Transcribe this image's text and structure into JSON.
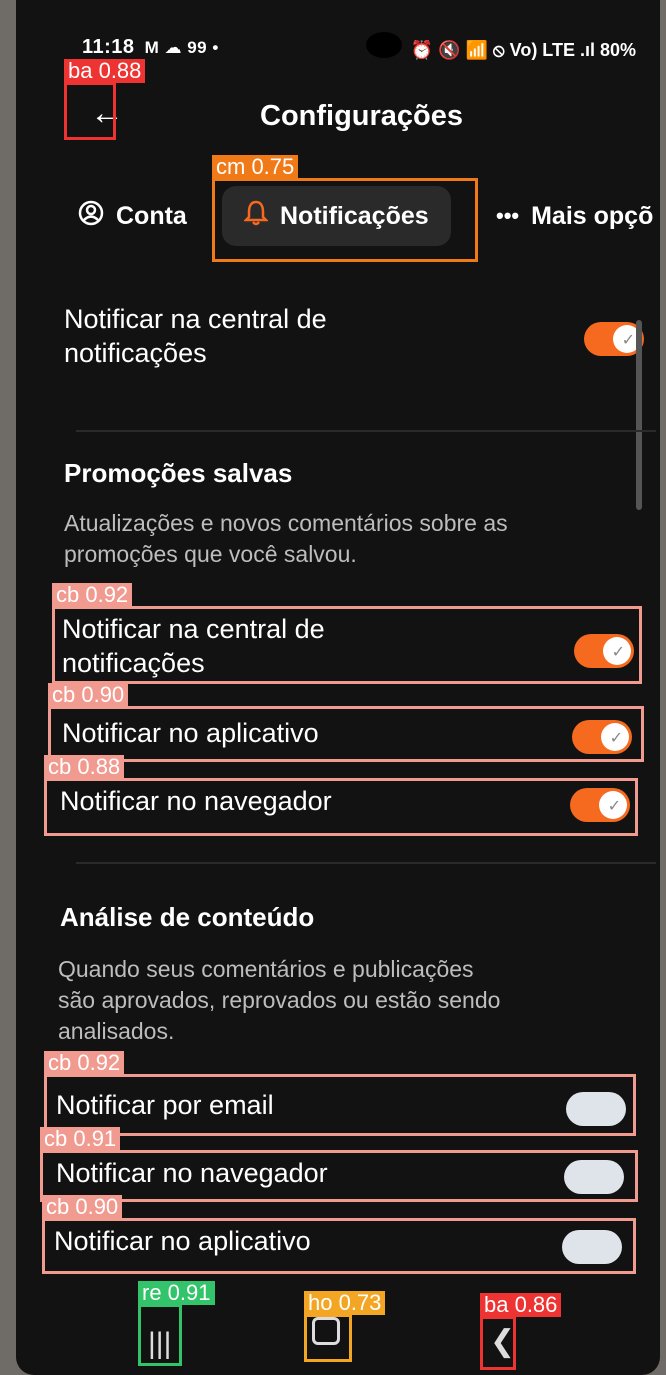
{
  "status": {
    "time": "11:18",
    "left_extra": "M ☁ 99 •",
    "right": "⏰ 🔇 📶 ⦸ Vo) LTE .ıl 80%"
  },
  "header": {
    "title": "Configurações",
    "back_icon": "arrow-left-icon"
  },
  "tabs": [
    {
      "label": "Conta",
      "icon": "user-circle-icon"
    },
    {
      "label": "Notificações",
      "icon": "bell-icon",
      "active": true
    },
    {
      "label": "Mais opçõ",
      "icon": "more-horizontal-icon"
    }
  ],
  "first_setting": {
    "label_line1": "Notificar na central de",
    "label_line2": "notificações",
    "on": true
  },
  "sections": [
    {
      "title": "Promoções salvas",
      "desc_line1": "Atualizações e novos comentários sobre as",
      "desc_line2": "promoções que você salvou.",
      "items": [
        {
          "label_line1": "Notificar na central de",
          "label_line2": "notificações",
          "on": true
        },
        {
          "label": "Notificar no aplicativo",
          "on": true
        },
        {
          "label": "Notificar no navegador",
          "on": true
        }
      ]
    },
    {
      "title": "Análise de conteúdo",
      "desc_line1": "Quando seus comentários e publicações",
      "desc_line2": "são aprovados, reprovados ou estão sendo",
      "desc_line3": "analisados.",
      "items": [
        {
          "label": "Notificar por email",
          "on": false
        },
        {
          "label": "Notificar no navegador",
          "on": false
        },
        {
          "label": "Notificar no aplicativo",
          "on": false
        }
      ]
    }
  ],
  "detections": {
    "back_top": "ba 0.88",
    "tab": "cm 0.75",
    "cb1": "cb 0.92",
    "cb2": "cb 0.90",
    "cb3": "cb 0.88",
    "cb4": "cb 0.92",
    "cb5": "cb 0.91",
    "cb6": "cb 0.90",
    "recent": "re 0.91",
    "home": "ho 0.73",
    "back_bottom": "ba 0.86"
  },
  "colors": {
    "accent": "#f56a1f",
    "background": "#121212",
    "box_red": "#ee3333",
    "box_orange": "#f07a18",
    "box_pink": "#f19a90",
    "box_green": "#33c46b",
    "box_yellow": "#f2a623"
  }
}
